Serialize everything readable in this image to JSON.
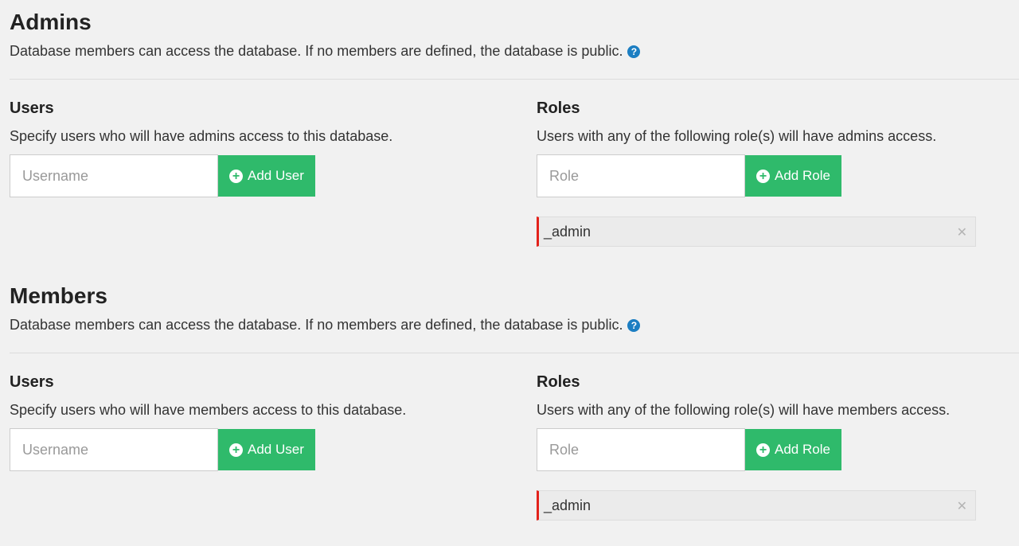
{
  "sections": {
    "admins": {
      "title": "Admins",
      "description": "Database members can access the database. If no members are defined, the database is public.",
      "users": {
        "title": "Users",
        "description": "Specify users who will have admins access to this database.",
        "placeholder": "Username",
        "button_label": "Add User"
      },
      "roles": {
        "title": "Roles",
        "description": "Users with any of the following role(s) will have admins access.",
        "placeholder": "Role",
        "button_label": "Add Role",
        "items": [
          "_admin"
        ]
      }
    },
    "members": {
      "title": "Members",
      "description": "Database members can access the database. If no members are defined, the database is public.",
      "users": {
        "title": "Users",
        "description": "Specify users who will have members access to this database.",
        "placeholder": "Username",
        "button_label": "Add User"
      },
      "roles": {
        "title": "Roles",
        "description": "Users with any of the following role(s) will have members access.",
        "placeholder": "Role",
        "button_label": "Add Role",
        "items": [
          "_admin"
        ]
      }
    }
  },
  "icons": {
    "help": "question-circle-icon",
    "add": "plus-circle-icon",
    "remove": "close-icon"
  },
  "colors": {
    "background": "#f1f1f1",
    "add_button": "#2fba6b",
    "help_icon": "#1c7ec2",
    "role_tag_accent": "#e3221b"
  }
}
